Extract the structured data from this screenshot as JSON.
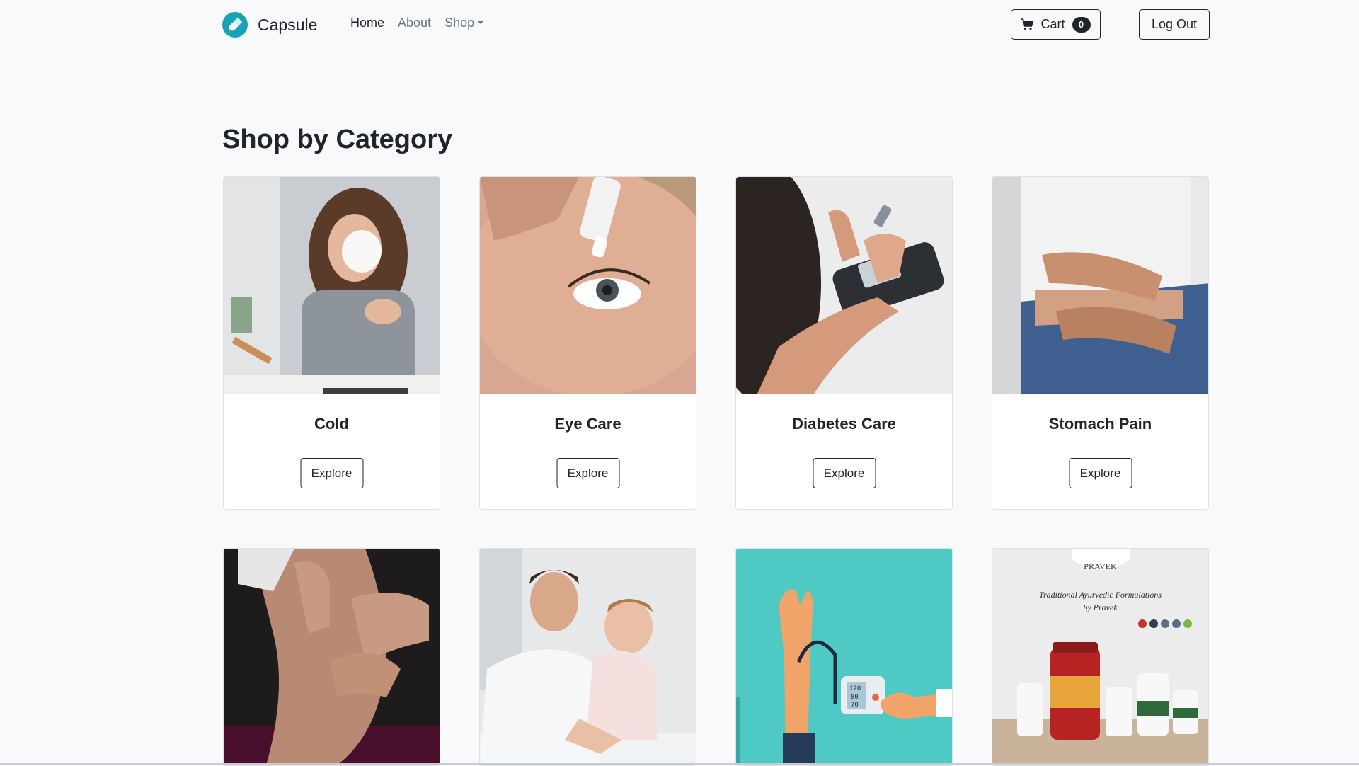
{
  "brand": {
    "name": "Capsule"
  },
  "nav": {
    "home": "Home",
    "about": "About",
    "shop": "Shop"
  },
  "cart": {
    "label": "Cart",
    "count": "0"
  },
  "logout": {
    "label": "Log Out"
  },
  "section": {
    "title": "Shop by Category"
  },
  "categories": [
    {
      "title": "Cold",
      "button": "Explore",
      "image": "woman-sneezing-tissue-photo"
    },
    {
      "title": "Eye Care",
      "button": "Explore",
      "image": "eye-drops-photo"
    },
    {
      "title": "Diabetes Care",
      "button": "Explore",
      "image": "glucose-meter-photo"
    },
    {
      "title": "Stomach Pain",
      "button": "Explore",
      "image": "stomach-pain-photo"
    },
    {
      "title": "",
      "button": "",
      "image": "knee-pain-photo"
    },
    {
      "title": "",
      "button": "",
      "image": "doctor-with-baby-photo"
    },
    {
      "title": "",
      "button": "",
      "image": "blood-pressure-monitor-illustration"
    },
    {
      "title": "",
      "button": "",
      "image": "ayurvedic-products-photo"
    }
  ],
  "promo": {
    "brand": "PRAVEK",
    "line1": "Traditional Ayurvedic Formulations",
    "line2": "by Pravek"
  },
  "colors": {
    "background": "#f8f9fa",
    "brand_accent": "#17a2b8",
    "text_dark": "#212529",
    "text_muted": "#6c757d"
  }
}
